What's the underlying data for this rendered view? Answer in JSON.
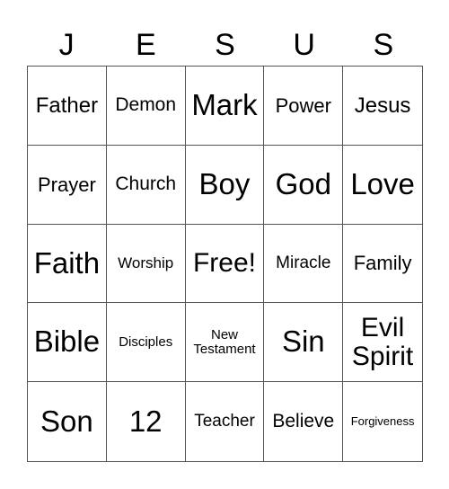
{
  "header": {
    "letters": [
      "J",
      "E",
      "S",
      "U",
      "S"
    ]
  },
  "cells": [
    "Father",
    "Demon",
    "Mark",
    "Power",
    "Jesus",
    "Prayer",
    "Church",
    "Boy",
    "God",
    "Love",
    "Faith",
    "Worship",
    "Free!",
    "Miracle",
    "Family",
    "Bible",
    "Disciples",
    "New Testament",
    "Sin",
    "Evil Spirit",
    "Son",
    "12",
    "Teacher",
    "Believe",
    "Forgiveness"
  ]
}
